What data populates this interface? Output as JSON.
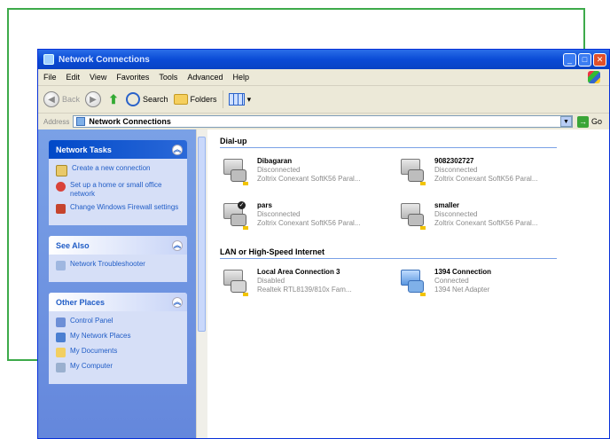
{
  "window": {
    "title": "Network Connections"
  },
  "menubar": {
    "items": [
      "File",
      "Edit",
      "View",
      "Favorites",
      "Tools",
      "Advanced",
      "Help"
    ]
  },
  "toolbar": {
    "back_label": "Back",
    "search_label": "Search",
    "folders_label": "Folders"
  },
  "addressbar": {
    "label": "Address",
    "value": "Network Connections",
    "go_label": "Go"
  },
  "left_pane": {
    "network_tasks": {
      "title": "Network Tasks",
      "items": [
        {
          "label": "Create a new connection",
          "icon": "new-connection-icon"
        },
        {
          "label": "Set up a home or small office network",
          "icon": "home-network-icon"
        },
        {
          "label": "Change Windows Firewall settings",
          "icon": "firewall-icon"
        }
      ]
    },
    "see_also": {
      "title": "See Also",
      "items": [
        {
          "label": "Network Troubleshooter",
          "icon": "troubleshooter-icon"
        }
      ]
    },
    "other_places": {
      "title": "Other Places",
      "items": [
        {
          "label": "Control Panel",
          "icon": "control-panel-icon"
        },
        {
          "label": "My Network Places",
          "icon": "network-places-icon"
        },
        {
          "label": "My Documents",
          "icon": "documents-icon"
        },
        {
          "label": "My Computer",
          "icon": "computer-icon"
        }
      ]
    }
  },
  "content": {
    "groups": [
      {
        "title": "Dial-up",
        "connections": [
          {
            "name": "Dibagaran",
            "status": "Disconnected",
            "device": "Zoltrix Conexant SoftK56 Paral..."
          },
          {
            "name": "9082302727",
            "status": "Disconnected",
            "device": "Zoltrix Conexant SoftK56 Paral..."
          },
          {
            "name": "pars",
            "status": "Disconnected",
            "device": "Zoltrix Conexant SoftK56 Paral...",
            "default": true
          },
          {
            "name": "smaller",
            "status": "Disconnected",
            "device": "Zoltrix Conexant SoftK56 Paral..."
          }
        ]
      },
      {
        "title": "LAN or High-Speed Internet",
        "connections": [
          {
            "name": "Local Area Connection 3",
            "status": "Disabled",
            "device": "Realtek RTL8139/810x Fam..."
          },
          {
            "name": "1394 Connection",
            "status": "Connected",
            "device": "1394 Net Adapter"
          }
        ]
      }
    ]
  },
  "colors": {
    "frame_line": "#3daa4a",
    "title_bar": "#0a4bd6",
    "task_pane": "#6487dc",
    "link_text": "#215dc6"
  }
}
